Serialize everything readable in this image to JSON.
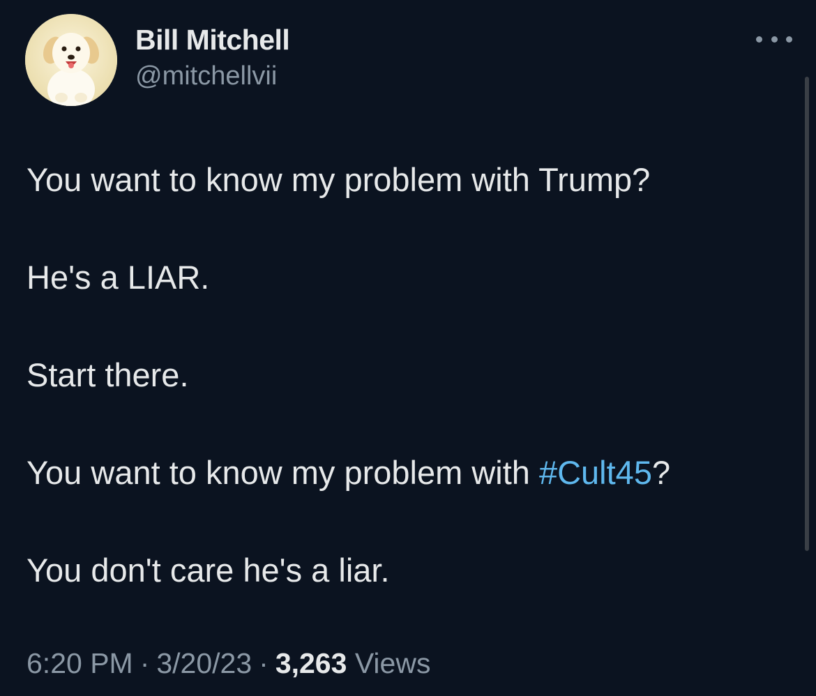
{
  "author": {
    "display_name": "Bill Mitchell",
    "handle": "@mitchellvii",
    "avatar_icon": "puppy-avatar-icon"
  },
  "more_icon": "ellipsis-icon",
  "tweet": {
    "line1": "You want to know my problem with Trump?",
    "line2": "He's a LIAR.",
    "line3": "Start there.",
    "line4_prefix": "You want to know my problem with ",
    "line4_hashtag": "#Cult45",
    "line4_suffix": "?",
    "line5": "You don't care he's a liar."
  },
  "meta": {
    "time": "6:20 PM",
    "separator": "·",
    "date": "3/20/23",
    "views_count": "3,263",
    "views_label": "Views"
  },
  "colors": {
    "background": "#0b1320",
    "text": "#e7e9ea",
    "secondary_text": "#8b98a5",
    "hashtag": "#5fb8ee"
  }
}
